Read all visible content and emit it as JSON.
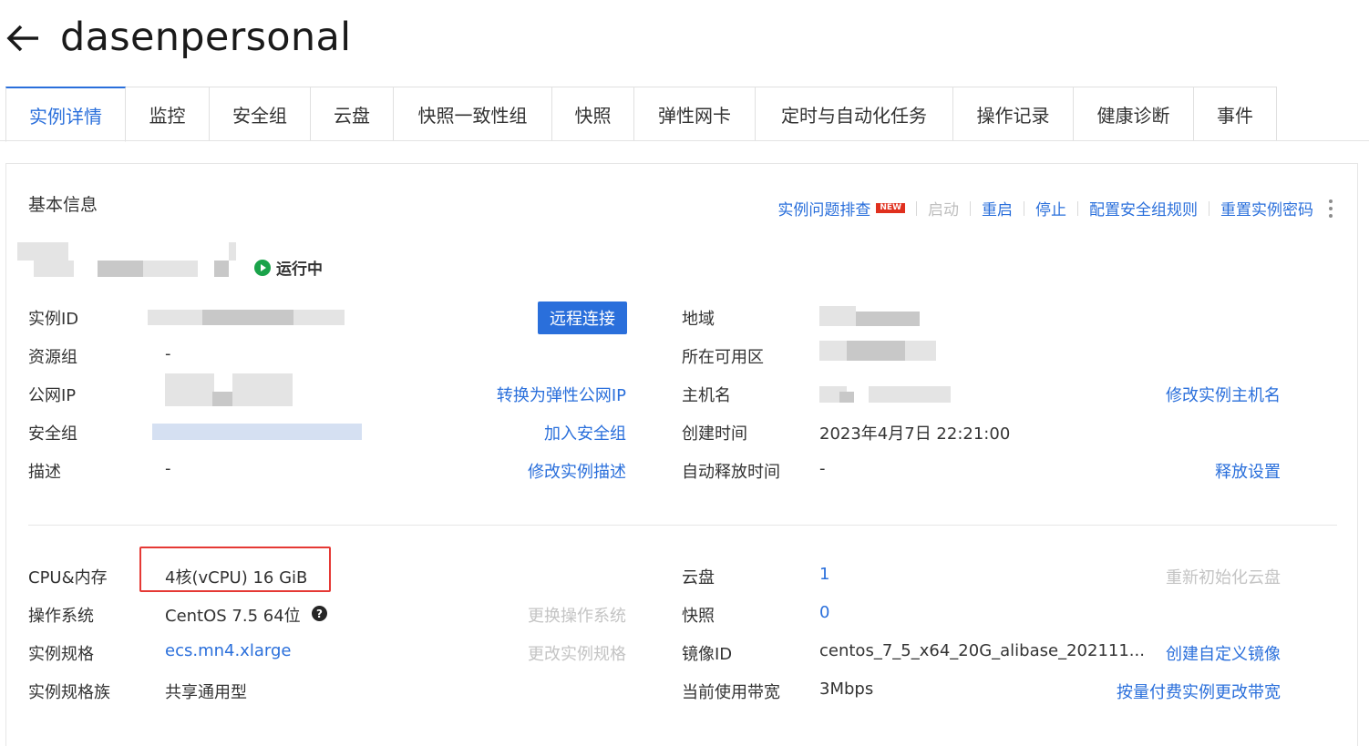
{
  "header": {
    "title": "dasenpersonal",
    "back_icon": "arrow-left-icon"
  },
  "tabs": [
    {
      "label": "实例详情",
      "active": true
    },
    {
      "label": "监控"
    },
    {
      "label": "安全组"
    },
    {
      "label": "云盘"
    },
    {
      "label": "快照一致性组"
    },
    {
      "label": "快照"
    },
    {
      "label": "弹性网卡"
    },
    {
      "label": "定时与自动化任务"
    },
    {
      "label": "操作记录"
    },
    {
      "label": "健康诊断"
    },
    {
      "label": "事件"
    }
  ],
  "basic": {
    "title": "基本信息",
    "actions": {
      "troubleshoot": "实例问题排查",
      "new_badge": "NEW",
      "start": "启动",
      "restart": "重启",
      "stop": "停止",
      "config_sg": "配置安全组规则",
      "reset_pwd": "重置实例密码"
    },
    "status": "运行中",
    "left": {
      "instance_id_label": "实例ID",
      "remote_btn": "远程连接",
      "resource_group_label": "资源组",
      "resource_group_value": "-",
      "public_ip_label": "公网IP",
      "convert_eip": "转换为弹性公网IP",
      "security_group_label": "安全组",
      "join_sg": "加入安全组",
      "desc_label": "描述",
      "desc_value": "-",
      "edit_desc": "修改实例描述"
    },
    "right": {
      "region_label": "地域",
      "zone_label": "所在可用区",
      "hostname_label": "主机名",
      "edit_hostname": "修改实例主机名",
      "created_label": "创建时间",
      "created_value": "2023年4月7日 22:21:00",
      "release_label": "自动释放时间",
      "release_value": "-",
      "release_setting": "释放设置"
    }
  },
  "config": {
    "left": {
      "cpu_label": "CPU&内存",
      "cpu_value": "4核(vCPU) 16 GiB",
      "os_label": "操作系统",
      "os_value": "CentOS 7.5 64位",
      "change_os": "更换操作系统",
      "spec_label": "实例规格",
      "spec_value": "ecs.mn4.xlarge",
      "change_spec": "更改实例规格",
      "family_label": "实例规格族",
      "family_value": "共享通用型"
    },
    "right": {
      "disk_label": "云盘",
      "disk_value": "1",
      "reinit_disk": "重新初始化云盘",
      "snapshot_label": "快照",
      "snapshot_value": "0",
      "image_label": "镜像ID",
      "image_value": "centos_7_5_x64_20G_alibase_202111...",
      "create_image": "创建自定义镜像",
      "bandwidth_label": "当前使用带宽",
      "bandwidth_value": "3Mbps",
      "change_bandwidth": "按量付费实例更改带宽"
    }
  },
  "colors": {
    "accent": "#2a6fdb",
    "running": "#1aa34a",
    "highlight": "#e53935"
  }
}
